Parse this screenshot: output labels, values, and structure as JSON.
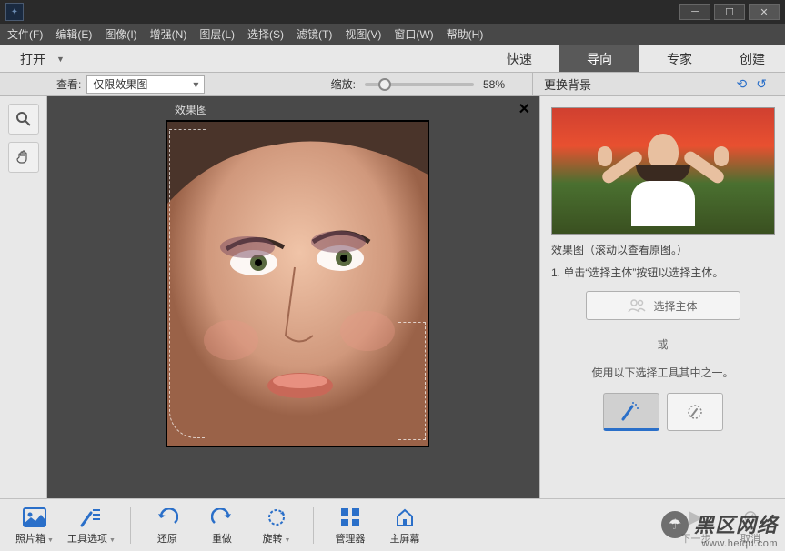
{
  "menu": [
    "文件(F)",
    "编辑(E)",
    "图像(I)",
    "增强(N)",
    "图层(L)",
    "选择(S)",
    "滤镜(T)",
    "视图(V)",
    "窗口(W)",
    "帮助(H)"
  ],
  "open_label": "打开",
  "modes": {
    "quick": "快速",
    "guided": "导向",
    "expert": "专家"
  },
  "create_label": "创建",
  "view_label": "查看:",
  "view_value": "仅限效果图",
  "zoom_label": "缩放:",
  "zoom_value": "58%",
  "zoom_pos_pct": 18,
  "sidebar_title": "更换背景",
  "canvas_title": "效果图",
  "right": {
    "caption": "效果图（滚动以查看原图。）",
    "step1": "1. 单击“选择主体”按钮以选择主体。",
    "select_btn": "选择主体",
    "or": "或",
    "tool_hint": "使用以下选择工具其中之一。"
  },
  "bottom": {
    "photobin": "照片箱",
    "tooloptions": "工具选项",
    "undo": "还原",
    "redo": "重做",
    "rotate": "旋转",
    "organizer": "管理器",
    "home": "主屏幕",
    "next": "下一步",
    "cancel": "取消"
  },
  "watermark": {
    "line1": "黑区网络",
    "line2": "www.heiqu.com"
  }
}
